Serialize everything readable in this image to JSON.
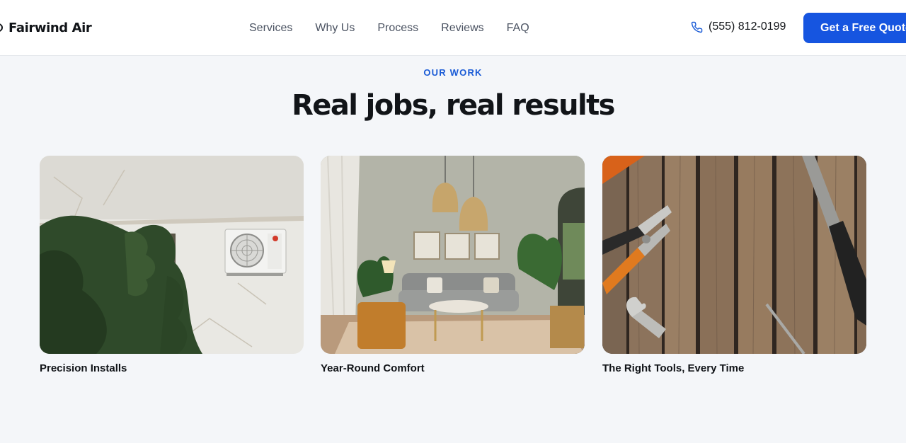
{
  "header": {
    "brand": "Fairwind Air",
    "nav": [
      "Services",
      "Why Us",
      "Process",
      "Reviews",
      "FAQ"
    ],
    "phone": "(555) 812-0199",
    "cta": "Get a Free Quote"
  },
  "section": {
    "eyebrow": "OUR WORK",
    "title": "Real jobs, real results",
    "cards": [
      {
        "title": "Precision Installs"
      },
      {
        "title": "Year-Round Comfort"
      },
      {
        "title": "The Right Tools, Every Time"
      }
    ]
  },
  "colors": {
    "accent": "#1655e0",
    "eyebrow": "#1a5bd6",
    "background": "#f4f6f9"
  },
  "icons": [
    "phone-icon",
    "brand-logo-icon"
  ]
}
